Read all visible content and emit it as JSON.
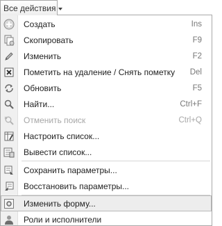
{
  "trigger": {
    "label": "Все действия"
  },
  "menu": {
    "items": [
      {
        "label": "Создать",
        "shortcut": "Ins",
        "icon": "create-plus-icon",
        "disabled": false
      },
      {
        "label": "Скопировать",
        "shortcut": "F9",
        "icon": "copy-icon",
        "disabled": false
      },
      {
        "label": "Изменить",
        "shortcut": "F2",
        "icon": "pencil-icon",
        "disabled": false
      },
      {
        "label": "Пометить на удаление / Снять пометку",
        "shortcut": "Del",
        "icon": "delete-mark-icon",
        "disabled": false
      },
      {
        "label": "Обновить",
        "shortcut": "F5",
        "icon": "refresh-icon",
        "disabled": false
      },
      {
        "label": "Найти...",
        "shortcut": "Ctrl+F",
        "icon": "search-icon",
        "disabled": false
      },
      {
        "label": "Отменить поиск",
        "shortcut": "Ctrl+Q",
        "icon": "cancel-search-icon",
        "disabled": true
      },
      {
        "label": "Настроить список...",
        "shortcut": "",
        "icon": "list-settings-icon",
        "disabled": false
      },
      {
        "label": "Вывести список...",
        "shortcut": "",
        "icon": "output-list-icon",
        "disabled": false
      },
      {
        "label": "Сохранить параметры...",
        "shortcut": "",
        "icon": "save-settings-icon",
        "disabled": false
      },
      {
        "label": "Восстановить параметры...",
        "shortcut": "",
        "icon": "restore-settings-icon",
        "disabled": false
      },
      {
        "label": "Изменить форму...",
        "shortcut": "",
        "icon": "change-form-icon",
        "disabled": false,
        "highlighted": true
      },
      {
        "label": "Роли и исполнители",
        "shortcut": "",
        "icon": "roles-performers-icon",
        "disabled": false
      }
    ]
  }
}
